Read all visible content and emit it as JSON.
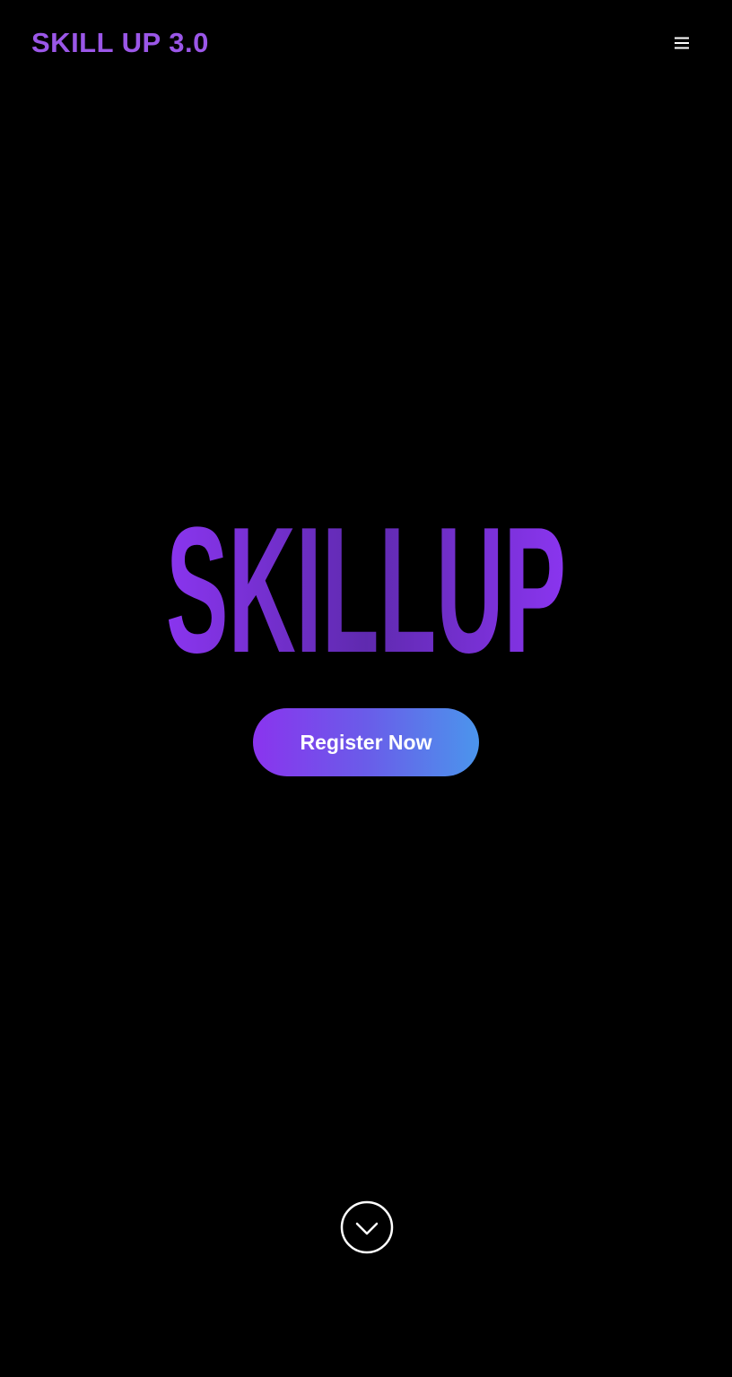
{
  "header": {
    "brand": "SKILL UP 3.0",
    "menu_icon": "hamburger-menu-icon"
  },
  "hero": {
    "wordmark": "SKILLUP",
    "register_label": "Register Now"
  },
  "scroll": {
    "icon": "chevron-down-circle-icon"
  },
  "colors": {
    "background": "#000000",
    "brand": "#9b57e8",
    "wordmark_start": "#8a35ef",
    "wordmark_mid": "#5f2aaf",
    "wordmark_end": "#8a35ef",
    "button_start": "#8a34ee",
    "button_end": "#4b95ec",
    "icon": "#ffffff"
  }
}
